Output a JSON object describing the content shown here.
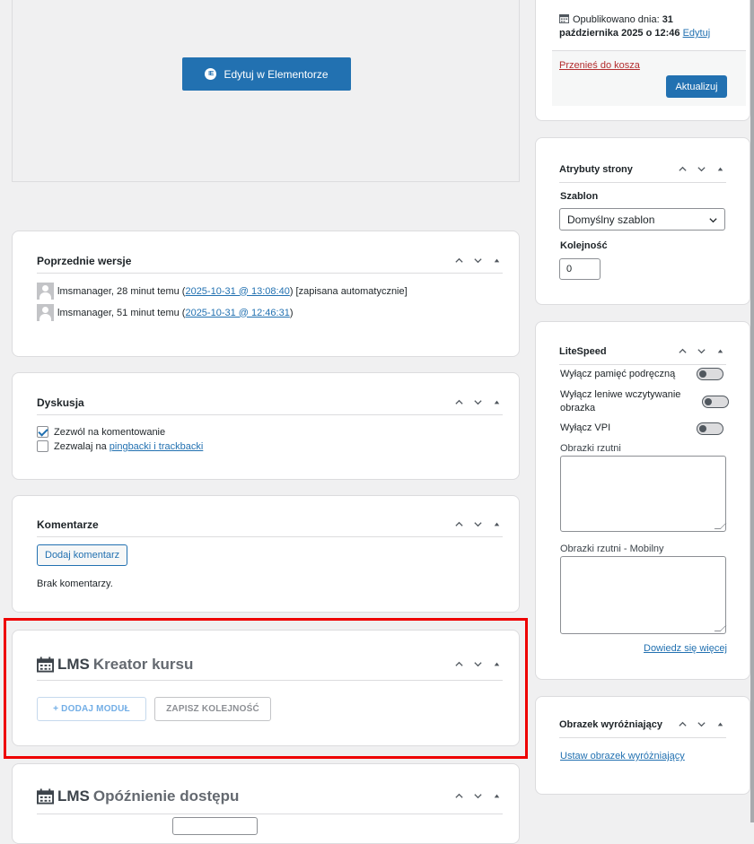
{
  "elementor": {
    "button_label": "Edytuj w Elementorze"
  },
  "revisions": {
    "title": "Poprzednie wersje",
    "items": [
      {
        "prefix": "lmsmanager, 28 minut temu (",
        "link": "2025-10-31 @ 13:08:40",
        "suffix": ") [zapisana automatycznie]"
      },
      {
        "prefix": "lmsmanager, 51 minut temu (",
        "link": "2025-10-31 @ 12:46:31",
        "suffix": ")"
      }
    ]
  },
  "discussion": {
    "title": "Dyskusja",
    "allow_comments": "Zezwól na komentowanie",
    "allow_pings_prefix": "Zezwalaj na ",
    "allow_pings_link": "pingbacki i trackbacki"
  },
  "comments": {
    "title": "Komentarze",
    "add_button": "Dodaj komentarz",
    "empty": "Brak komentarzy."
  },
  "lms_builder": {
    "title_prefix": "LMS",
    "title_accent": "Kreator kursu",
    "add_module": "+ DODAJ MODUŁ",
    "save_order": "ZAPISZ KOLEJNOŚĆ"
  },
  "lms_delay": {
    "title_prefix": "LMS",
    "title_accent": "Opóźnienie dostępu"
  },
  "publish": {
    "published_label": "Opublikowano dnia:",
    "published_date_1": "31",
    "published_date_2": "października 2025 o 12:46",
    "edit_link": "Edytuj",
    "trash_link": "Przenieś do kosza",
    "update_button": "Aktualizuj"
  },
  "attributes": {
    "title": "Atrybuty strony",
    "template_label": "Szablon",
    "template_value": "Domyślny szablon",
    "order_label": "Kolejność",
    "order_value": "0"
  },
  "litespeed": {
    "title": "LiteSpeed",
    "opt1": "Wyłącz pamięć podręczną",
    "opt2a": "Wyłącz leniwe wczytywanie",
    "opt2b": "obrazka",
    "opt3": "Wyłącz VPI",
    "vpi_label": "Obrazki rzutni",
    "vpi_mobile_label": "Obrazki rzutni - Mobilny",
    "learn_more": "Dowiedz się więcej"
  },
  "featured": {
    "title": "Obrazek wyróżniający",
    "set_link": "Ustaw obrazek wyróżniający"
  },
  "colors": {
    "accent": "#2271b1",
    "highlight": "#e00000"
  }
}
